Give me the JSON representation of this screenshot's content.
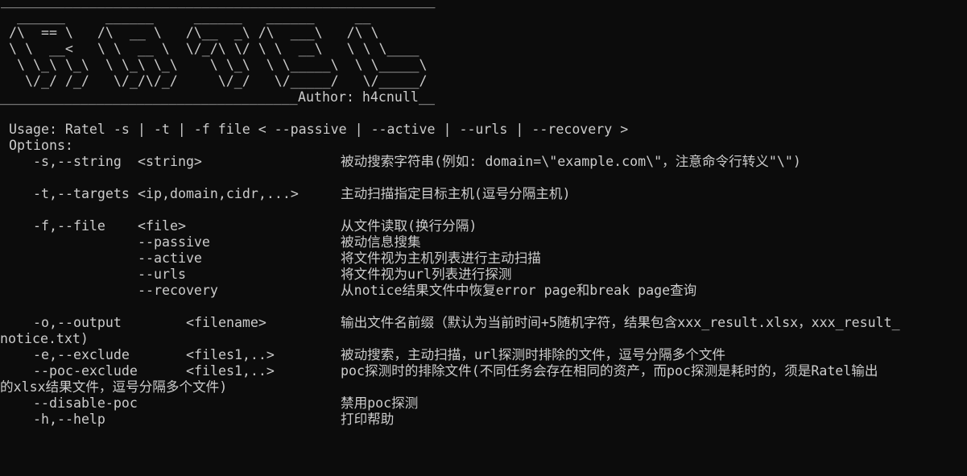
{
  "terminal": {
    "background": "#0c0c0c",
    "foreground": "#cccccc"
  },
  "banner": {
    "top_rule": "______________________________________________________",
    "art": [
      "  ______     ______     ______   ______     __",
      " /\\  == \\   /\\  __ \\   /\\__  _\\ /\\  ___\\   /\\ \\",
      " \\ \\  __<   \\ \\  __ \\  \\/_/\\ \\/ \\ \\  __\\   \\ \\ \\____",
      "  \\ \\_\\ \\_\\  \\ \\_\\ \\_\\    \\ \\_\\  \\ \\_____\\  \\ \\_____\\",
      "   \\/_/ /_/   \\/_/\\/_/     \\/_/   \\/_____/   \\/_____/"
    ],
    "bottom_rule": "_____________________________________",
    "author": "Author: h4cnull",
    "author_tail": "__"
  },
  "usage": "Usage: Ratel -s | -t | -f file < --passive | --active | --urls | --recovery >",
  "options_label": "Options:",
  "options": {
    "string": {
      "flag": "-s,--string",
      "arg": "<string>",
      "desc": "被动搜索字符串(例如: domain=\\\"example.com\\\"，注意命令行转义\"\\\")"
    },
    "targets": {
      "flag": "-t,--targets",
      "arg": "<ip,domain,cidr,...>",
      "desc": "主动扫描指定目标主机(逗号分隔主机)"
    },
    "file": {
      "flag": "-f,--file",
      "arg": "<file>",
      "desc": "从文件读取(换行分隔)"
    },
    "passive": {
      "flag": "--passive",
      "desc": "被动信息搜集"
    },
    "active": {
      "flag": "--active",
      "desc": "将文件视为主机列表进行主动扫描"
    },
    "urls": {
      "flag": "--urls",
      "desc": "将文件视为url列表进行探测"
    },
    "recovery": {
      "flag": "--recovery",
      "desc": "从notice结果文件中恢复error page和break page查询"
    },
    "output": {
      "flag": "-o,--output",
      "arg": "<filename>",
      "desc": "输出文件名前缀（默认为当前时间+5随机字符，结果包含xxx_result.xlsx，xxx_result_",
      "desc_wrap": "notice.txt)"
    },
    "exclude": {
      "flag": "-e,--exclude",
      "arg": "<files1,..>",
      "desc": "被动搜索，主动扫描，url探测时排除的文件，逗号分隔多个文件"
    },
    "poc_exclude": {
      "flag": "--poc-exclude",
      "arg": "<files1,..>",
      "desc": "poc探测时的排除文件(不同任务会存在相同的资产，而poc探测是耗时的，须是Ratel输出",
      "desc_wrap": "的xlsx结果文件，逗号分隔多个文件)"
    },
    "disable_poc": {
      "flag": "--disable-poc",
      "desc": "禁用poc探测"
    },
    "help": {
      "flag": "-h,--help",
      "desc": "打印帮助"
    }
  }
}
